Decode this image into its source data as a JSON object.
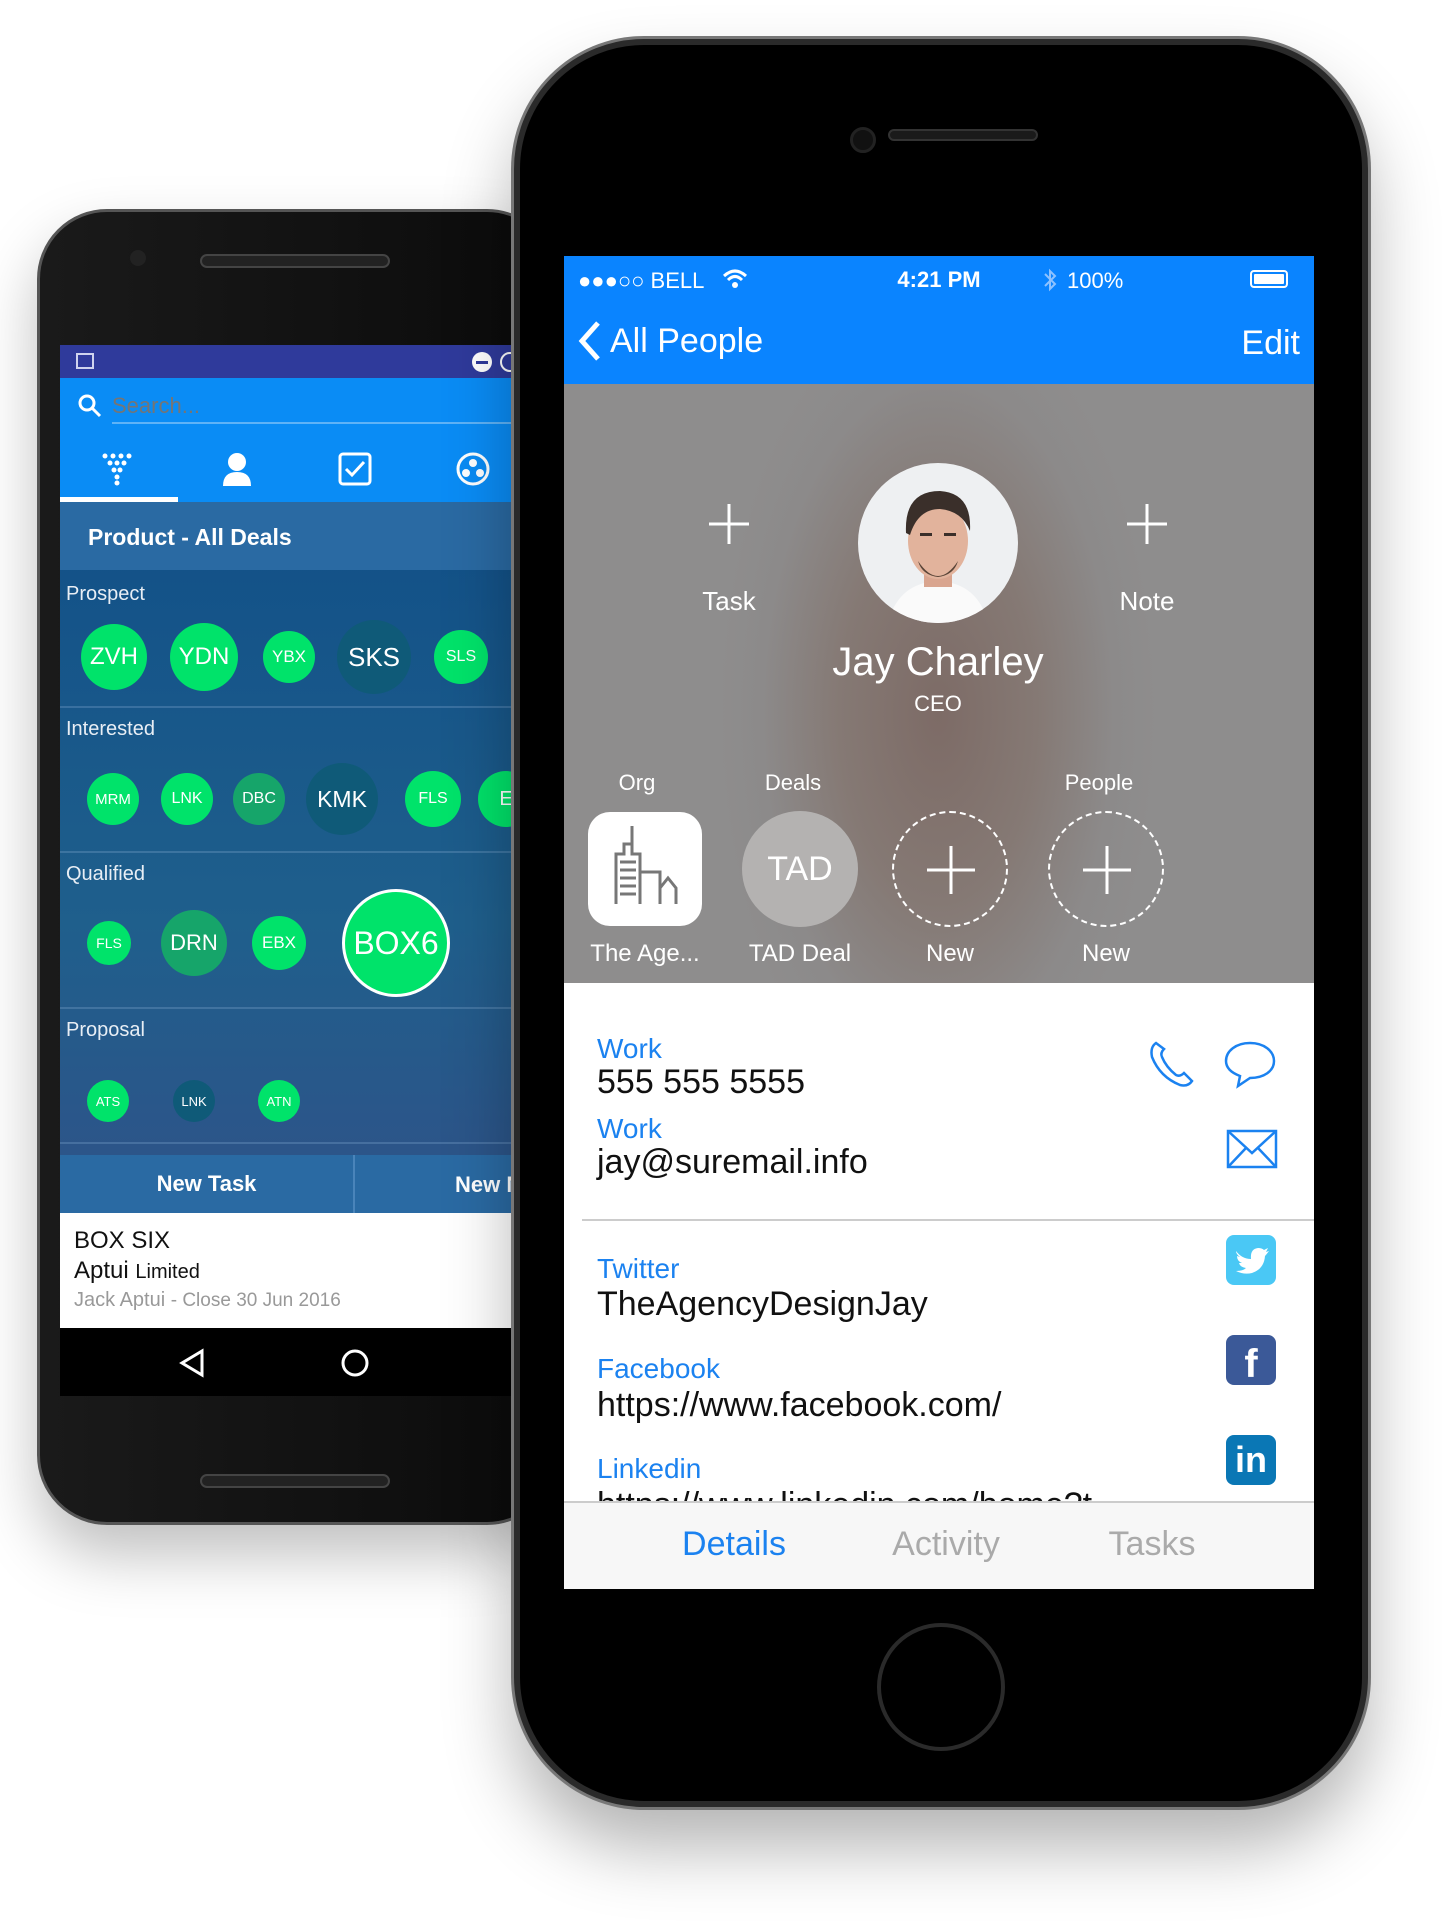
{
  "android": {
    "search_placeholder": "Search...",
    "tabs": [
      {
        "icon": "funnel-icon"
      },
      {
        "icon": "person-icon"
      },
      {
        "icon": "checkbox-icon"
      },
      {
        "icon": "group-icon"
      }
    ],
    "header_title": "Product - All Deals",
    "sections": [
      {
        "label": "Prospect",
        "chips": [
          {
            "code": "ZVH",
            "variant": "bright"
          },
          {
            "code": "YDN",
            "variant": "bright"
          },
          {
            "code": "YBX",
            "variant": "bright"
          },
          {
            "code": "SKS",
            "variant": "dark"
          },
          {
            "code": "SLS",
            "variant": "bright"
          }
        ]
      },
      {
        "label": "Interested",
        "chips": [
          {
            "code": "MRM",
            "variant": "bright"
          },
          {
            "code": "LNK",
            "variant": "bright"
          },
          {
            "code": "DBC",
            "variant": "muted"
          },
          {
            "code": "KMK",
            "variant": "dark"
          },
          {
            "code": "FLS",
            "variant": "bright"
          },
          {
            "code": "E",
            "variant": "bright"
          }
        ]
      },
      {
        "label": "Qualified",
        "chips": [
          {
            "code": "FLS",
            "variant": "bright"
          },
          {
            "code": "DRN",
            "variant": "muted"
          },
          {
            "code": "EBX",
            "variant": "bright"
          },
          {
            "code": "BOX6",
            "variant": "selected"
          }
        ]
      },
      {
        "label": "Proposal",
        "chips": [
          {
            "code": "ATS",
            "variant": "bright"
          },
          {
            "code": "LNK",
            "variant": "dark"
          },
          {
            "code": "ATN",
            "variant": "bright"
          }
        ]
      }
    ],
    "buttons": [
      "New Task",
      "New N"
    ],
    "card": {
      "title": "BOX SIX",
      "company": "Aptui",
      "company_suffix": "Limited",
      "contact": "Jack Aptui",
      "close": " - Close 30 Jun 2016"
    },
    "colors": {
      "bright": "#00e36a",
      "muted": "#16a56a",
      "dark": "#0f5a78",
      "accent": "#0a8cf5"
    }
  },
  "ios": {
    "status": {
      "carrier": "●●●○○ BELL",
      "time": "4:21 PM",
      "battery": "100%"
    },
    "nav": {
      "back_label": "All People",
      "edit_label": "Edit"
    },
    "actions": {
      "task": "Task",
      "note": "Note"
    },
    "person": {
      "name": "Jay Charley",
      "title": "CEO"
    },
    "links": {
      "headers": {
        "org": "Org",
        "deals": "Deals",
        "people": "People"
      },
      "items": [
        {
          "kind": "org",
          "label": "The Age..."
        },
        {
          "kind": "deal",
          "badge": "TAD",
          "label": "TAD Deal"
        },
        {
          "kind": "new",
          "label": "New"
        },
        {
          "kind": "new",
          "label": "New"
        }
      ]
    },
    "details": [
      {
        "label": "Work",
        "value": "555 555 5555",
        "icons": [
          "phone-icon",
          "message-icon"
        ]
      },
      {
        "label": "Work",
        "value": "jay@suremail.info",
        "icons": [
          "mail-icon"
        ]
      },
      {
        "label": "Twitter",
        "value": "TheAgencyDesignJay",
        "icons": [
          "twitter-icon"
        ]
      },
      {
        "label": "Facebook",
        "value": "https://www.facebook.com/",
        "icons": [
          "facebook-icon"
        ]
      },
      {
        "label": "Linkedin",
        "value": "https://www.linkedin.com/home?t...",
        "icons": [
          "linkedin-icon"
        ]
      }
    ],
    "tabs": [
      {
        "label": "Details",
        "active": true
      },
      {
        "label": "Activity",
        "active": false
      },
      {
        "label": "Tasks",
        "active": false
      }
    ],
    "colors": {
      "accent": "#0a84ff",
      "twitter": "#4ac8f5",
      "facebook": "#3b5998",
      "linkedin": "#0a77b5"
    }
  }
}
